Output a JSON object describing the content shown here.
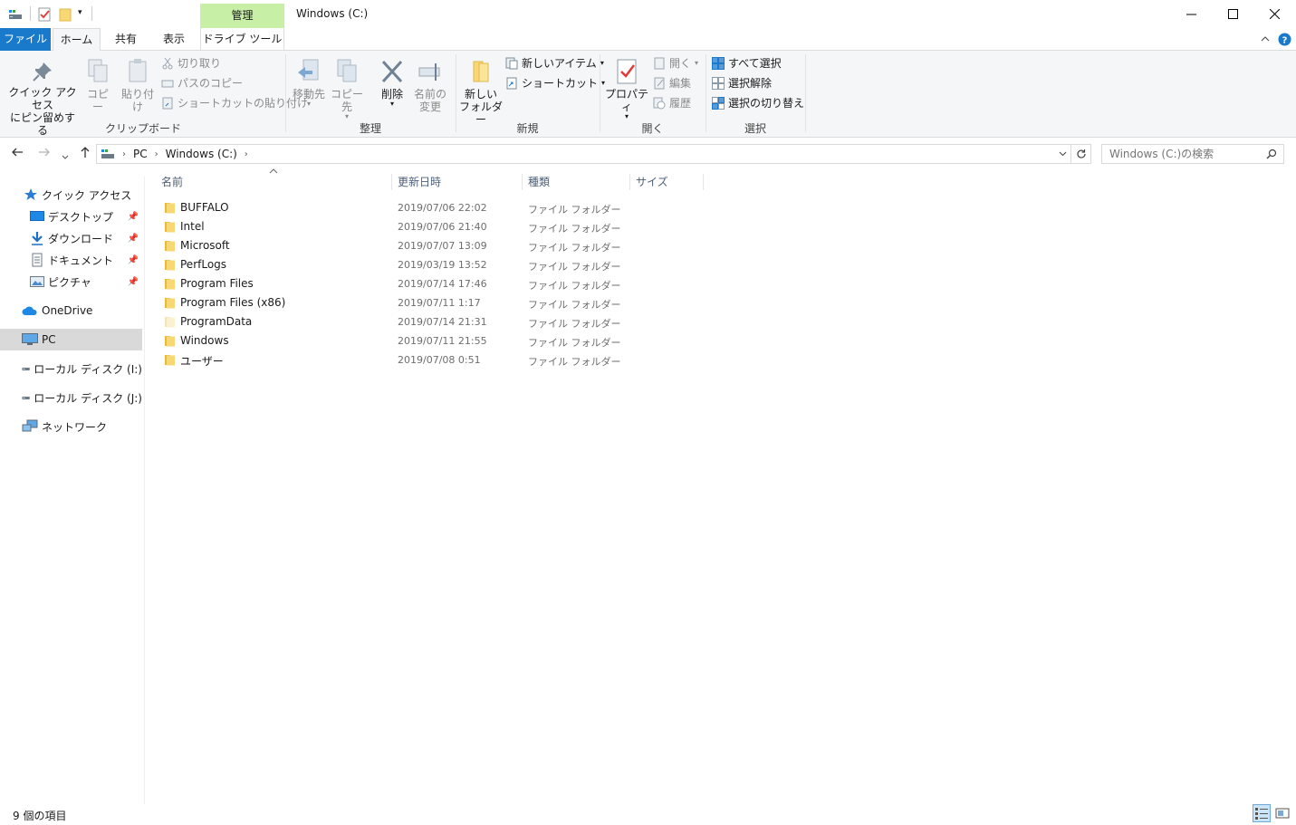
{
  "window": {
    "title": "Windows (C:)",
    "manage_tab": "管理",
    "drive_tools_tab": "ドライブ ツール",
    "minimize": "—",
    "maximize": "☐",
    "close": "✕",
    "help": "?",
    "collapse": "⌃"
  },
  "tabs": {
    "file": "ファイル",
    "home": "ホーム",
    "share": "共有",
    "view": "表示"
  },
  "ribbon": {
    "clipboard": {
      "label": "クリップボード",
      "pin_quick_access": [
        "クイック アクセス",
        "にピン留めする"
      ],
      "copy": "コピー",
      "paste": "貼り付け",
      "cut": "切り取り",
      "copy_path": "パスのコピー",
      "paste_shortcut": "ショートカットの貼り付け"
    },
    "organize": {
      "label": "整理",
      "move_to": "移動先",
      "copy_to": "コピー先",
      "delete": "削除",
      "rename": [
        "名前の",
        "変更"
      ]
    },
    "new": {
      "label": "新規",
      "new_folder": [
        "新しい",
        "フォルダー"
      ],
      "new_item": "新しいアイテム",
      "shortcut": "ショートカット"
    },
    "open": {
      "label": "開く",
      "properties": "プロパティ",
      "open": "開く",
      "edit": "編集",
      "history": "履歴"
    },
    "select": {
      "label": "選択",
      "select_all": "すべて選択",
      "select_none": "選択解除",
      "invert": "選択の切り替え"
    }
  },
  "address": {
    "crumbs": [
      "PC",
      "Windows (C:)"
    ],
    "search_placeholder": "Windows (C:)の検索"
  },
  "sidebar": {
    "quick_access": "クイック アクセス",
    "desktop": "デスクトップ",
    "downloads": "ダウンロード",
    "documents": "ドキュメント",
    "pictures": "ピクチャ",
    "onedrive": "OneDrive",
    "pc": "PC",
    "disk_i": "ローカル ディスク (I:)",
    "disk_j": "ローカル ディスク (J:)",
    "network": "ネットワーク"
  },
  "columns": {
    "name": "名前",
    "modified": "更新日時",
    "type": "種類",
    "size": "サイズ"
  },
  "files": [
    {
      "name": "BUFFALO",
      "modified": "2019/07/06 22:02",
      "type": "ファイル フォルダー"
    },
    {
      "name": "Intel",
      "modified": "2019/07/06 21:40",
      "type": "ファイル フォルダー"
    },
    {
      "name": "Microsoft",
      "modified": "2019/07/07 13:09",
      "type": "ファイル フォルダー"
    },
    {
      "name": "PerfLogs",
      "modified": "2019/03/19 13:52",
      "type": "ファイル フォルダー"
    },
    {
      "name": "Program Files",
      "modified": "2019/07/14 17:46",
      "type": "ファイル フォルダー"
    },
    {
      "name": "Program Files (x86)",
      "modified": "2019/07/11 1:17",
      "type": "ファイル フォルダー"
    },
    {
      "name": "ProgramData",
      "modified": "2019/07/14 21:31",
      "type": "ファイル フォルダー"
    },
    {
      "name": "Windows",
      "modified": "2019/07/11 21:55",
      "type": "ファイル フォルダー"
    },
    {
      "name": "ユーザー",
      "modified": "2019/07/08 0:51",
      "type": "ファイル フォルダー"
    }
  ],
  "status": {
    "item_count": "9 個の項目"
  },
  "colors": {
    "file_tab": "#1979ca",
    "manage_tab": "#c7efa5",
    "folder": "#f8d775",
    "selected_nav": "#d9d9d9"
  }
}
